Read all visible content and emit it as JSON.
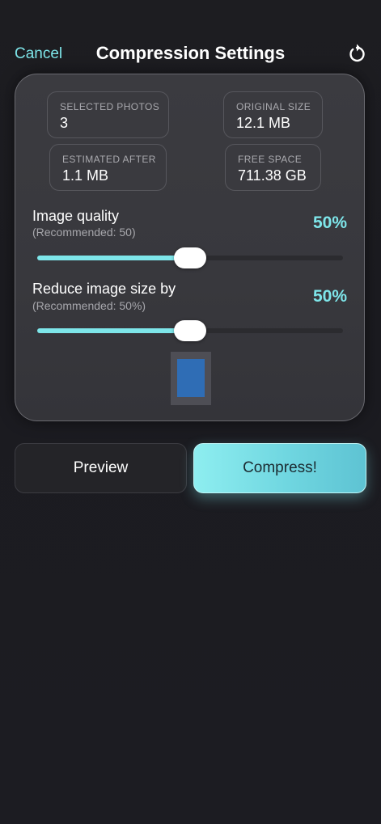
{
  "nav": {
    "cancel_label": "Cancel",
    "title": "Compression Settings",
    "reset_icon": "reset-icon"
  },
  "stats": {
    "selected_photos": {
      "label": "SELECTED PHOTOS",
      "value": "3"
    },
    "original_size": {
      "label": "ORIGINAL SIZE",
      "value": "12.1 MB"
    },
    "estimated_after": {
      "label": "ESTIMATED AFTER",
      "value": "1.1 MB"
    },
    "free_space": {
      "label": "FREE SPACE",
      "value": "711.38 GB"
    }
  },
  "settings": {
    "image_quality": {
      "title": "Image quality",
      "recommendation": "(Recommended: 50)",
      "value_label": "50%",
      "level": 0.5
    },
    "reduce_size": {
      "title": "Reduce image size by",
      "recommendation": "(Recommended: 50%)",
      "value_label": "50%",
      "level": 0.5
    }
  },
  "actions": {
    "preview_label": "Preview",
    "compress_label": "Compress!"
  },
  "colors": {
    "accent": "#7ee6ea",
    "background": "#1d1d21",
    "card": "#3b3b40",
    "preview_image": "#2f6db5"
  }
}
